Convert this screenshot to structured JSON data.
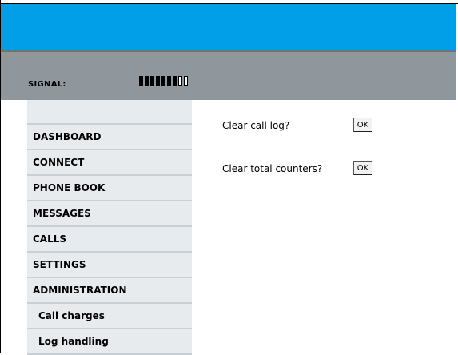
{
  "signal": {
    "label": "SIGNAL:",
    "level": 7,
    "max": 9
  },
  "nav": {
    "items": [
      {
        "label": "DASHBOARD",
        "name": "nav-dashboard"
      },
      {
        "label": "CONNECT",
        "name": "nav-connect"
      },
      {
        "label": "PHONE BOOK",
        "name": "nav-phone-book"
      },
      {
        "label": "MESSAGES",
        "name": "nav-messages"
      },
      {
        "label": "CALLS",
        "name": "nav-calls"
      },
      {
        "label": "SETTINGS",
        "name": "nav-settings"
      },
      {
        "label": "ADMINISTRATION",
        "name": "nav-administration"
      }
    ],
    "subitems": [
      {
        "label": "Call charges",
        "name": "nav-call-charges"
      },
      {
        "label": "Log handling",
        "name": "nav-log-handling"
      }
    ]
  },
  "main": {
    "clear_call_log": {
      "label": "Clear call log?",
      "button": "OK"
    },
    "clear_total_counters": {
      "label": "Clear total counters?",
      "button": "OK"
    }
  },
  "colors": {
    "header_blue": "#009fe8",
    "signal_bar_gray": "#8f979d",
    "nav_background": "#e7ebee"
  }
}
